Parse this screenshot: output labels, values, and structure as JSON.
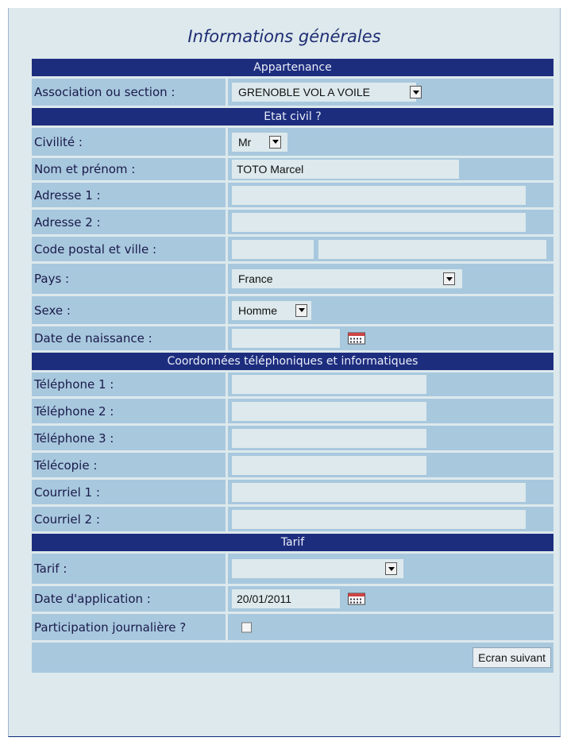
{
  "title": "Informations générales",
  "sections": {
    "appartenance": "Appartenance",
    "etat_civil": "Etat civil ?",
    "coordonnees": "Coordonnées téléphoniques et informatiques",
    "tarif": "Tarif"
  },
  "fields": {
    "association": {
      "label": "Association ou section :",
      "value": "GRENOBLE VOL A VOILE"
    },
    "civilite": {
      "label": "Civilité :",
      "value": "Mr"
    },
    "nom": {
      "label": "Nom et prénom :",
      "value": "TOTO Marcel"
    },
    "adresse1": {
      "label": "Adresse 1 :",
      "value": ""
    },
    "adresse2": {
      "label": "Adresse 2 :",
      "value": ""
    },
    "cp_ville": {
      "label": "Code postal et ville :",
      "cp": "",
      "ville": ""
    },
    "pays": {
      "label": "Pays :",
      "value": "France"
    },
    "sexe": {
      "label": "Sexe :",
      "value": "Homme"
    },
    "naissance": {
      "label": "Date de naissance :",
      "value": ""
    },
    "tel1": {
      "label": "Téléphone 1 :",
      "value": ""
    },
    "tel2": {
      "label": "Téléphone 2 :",
      "value": ""
    },
    "tel3": {
      "label": "Téléphone 3 :",
      "value": ""
    },
    "telecopie": {
      "label": "Télécopie :",
      "value": ""
    },
    "courriel1": {
      "label": "Courriel 1 :",
      "value": ""
    },
    "courriel2": {
      "label": "Courriel 2 :",
      "value": ""
    },
    "tarif": {
      "label": "Tarif :",
      "value": ""
    },
    "application": {
      "label": "Date d'application :",
      "value": "20/01/2011"
    },
    "participation": {
      "label": "Participation journalière ?",
      "checked": false
    }
  },
  "buttons": {
    "next": "Ecran suivant"
  },
  "icons": {
    "calendar": "calendar-icon",
    "dropdown": "chevron-down-icon"
  },
  "colors": {
    "header": "#1d2d7e",
    "row": "#a8c8de",
    "input": "#dde9ec",
    "title": "#1f2d74"
  }
}
